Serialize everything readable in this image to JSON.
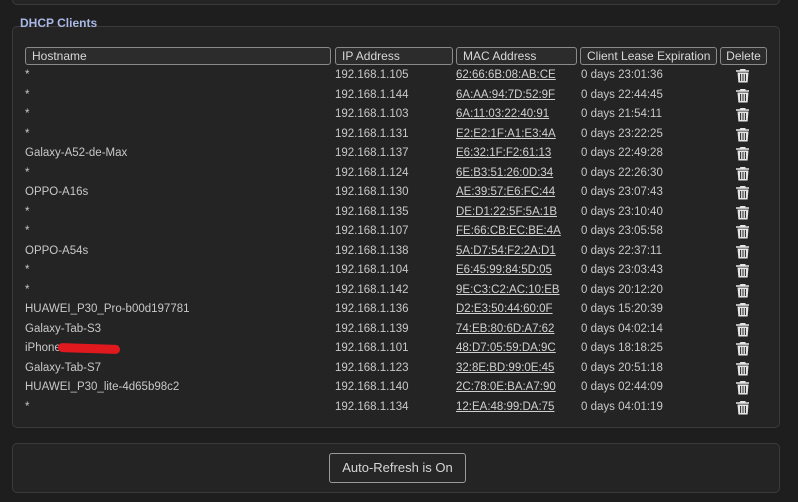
{
  "section_title": "DHCP Clients",
  "columns": {
    "hostname": "Hostname",
    "ip": "IP Address",
    "mac": "MAC Address",
    "lease": "Client Lease Expiration",
    "delete": "Delete"
  },
  "clients": [
    {
      "hostname": "*",
      "ip": "192.168.1.105",
      "mac": "62:66:6B:08:AB:CE",
      "lease": "0 days 23:01:36"
    },
    {
      "hostname": "*",
      "ip": "192.168.1.144",
      "mac": "6A:AA:94:7D:52:9F",
      "lease": "0 days 22:44:45"
    },
    {
      "hostname": "*",
      "ip": "192.168.1.103",
      "mac": "6A:11:03:22:40:91",
      "lease": "0 days 21:54:11"
    },
    {
      "hostname": "*",
      "ip": "192.168.1.131",
      "mac": "E2:E2:1F:A1:E3:4A",
      "lease": "0 days 23:22:25"
    },
    {
      "hostname": "Galaxy-A52-de-Max",
      "ip": "192.168.1.137",
      "mac": "E6:32:1F:F2:61:13",
      "lease": "0 days 22:49:28"
    },
    {
      "hostname": "*",
      "ip": "192.168.1.124",
      "mac": "6E:B3:51:26:0D:34",
      "lease": "0 days 22:26:30"
    },
    {
      "hostname": "OPPO-A16s",
      "ip": "192.168.1.130",
      "mac": "AE:39:57:E6:FC:44",
      "lease": "0 days 23:07:43"
    },
    {
      "hostname": "*",
      "ip": "192.168.1.135",
      "mac": "DE:D1:22:5F:5A:1B",
      "lease": "0 days 23:10:40"
    },
    {
      "hostname": "*",
      "ip": "192.168.1.107",
      "mac": "FE:66:CB:EC:BE:4A",
      "lease": "0 days 23:05:58"
    },
    {
      "hostname": "OPPO-A54s",
      "ip": "192.168.1.138",
      "mac": "5A:D7:54:F2:2A:D1",
      "lease": "0 days 22:37:11"
    },
    {
      "hostname": "*",
      "ip": "192.168.1.104",
      "mac": "E6:45:99:84:5D:05",
      "lease": "0 days 23:03:43"
    },
    {
      "hostname": "*",
      "ip": "192.168.1.142",
      "mac": "9E:C3:C2:AC:10:EB",
      "lease": "0 days 20:12:20"
    },
    {
      "hostname": "HUAWEI_P30_Pro-b00d197781",
      "ip": "192.168.1.136",
      "mac": "D2:E3:50:44:60:0F",
      "lease": "0 days 15:20:39"
    },
    {
      "hostname": "Galaxy-Tab-S3",
      "ip": "192.168.1.139",
      "mac": "74:EB:80:6D:A7:62",
      "lease": "0 days 04:02:14"
    },
    {
      "hostname": "iPhone",
      "ip": "192.168.1.101",
      "mac": "48:D7:05:59:DA:9C",
      "lease": "0 days 18:18:25"
    },
    {
      "hostname": "Galaxy-Tab-S7",
      "ip": "192.168.1.123",
      "mac": "32:8E:BD:99:0E:45",
      "lease": "0 days 20:51:18"
    },
    {
      "hostname": "HUAWEI_P30_lite-4d65b98c2",
      "ip": "192.168.1.140",
      "mac": "2C:78:0E:BA:A7:90",
      "lease": "0 days 02:44:09"
    },
    {
      "hostname": "*",
      "ip": "192.168.1.134",
      "mac": "12:EA:48:99:DA:75",
      "lease": "0 days 04:01:19"
    }
  ],
  "delete_icon": "trash-icon",
  "refresh_button": "Auto-Refresh is On",
  "colors": {
    "background": "#1e1e1e",
    "panel": "#242424",
    "title": "#a9b8e6",
    "text": "#c8c8c8",
    "redaction": "#e0191f"
  }
}
